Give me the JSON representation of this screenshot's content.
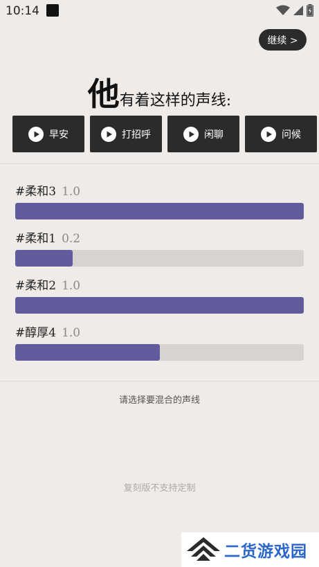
{
  "status_bar": {
    "time": "10:14",
    "icons": [
      "notification-square-icon",
      "wifi-icon",
      "signal-icon",
      "battery-icon"
    ]
  },
  "continue_button": {
    "label": "继续 >"
  },
  "headline": {
    "big_char": "他",
    "rest": "有着这样的声线:"
  },
  "voice_buttons": [
    {
      "label": "早安",
      "icon": "play-icon"
    },
    {
      "label": "打招呼",
      "icon": "play-icon"
    },
    {
      "label": "闲聊",
      "icon": "play-icon"
    },
    {
      "label": "问候",
      "icon": "play-icon"
    }
  ],
  "mix_items": [
    {
      "name": "#柔和3",
      "value": "1.0",
      "fill_fraction": 1.0
    },
    {
      "name": "#柔和1",
      "value": "0.2",
      "fill_fraction": 0.2
    },
    {
      "name": "#柔和2",
      "value": "1.0",
      "fill_fraction": 1.0
    },
    {
      "name": "#醇厚4",
      "value": "1.0",
      "fill_fraction": 0.5
    }
  ],
  "hint": "请选择要混合的声线",
  "notice": "复刻版不支持定制",
  "watermark": {
    "text": "二货游戏园"
  },
  "colors": {
    "accent": "#625b9c",
    "track": "#d8d2d1",
    "button_bg": "#2b2b2b",
    "background": "#efebe8",
    "watermark_blue": "#2b66c9"
  }
}
